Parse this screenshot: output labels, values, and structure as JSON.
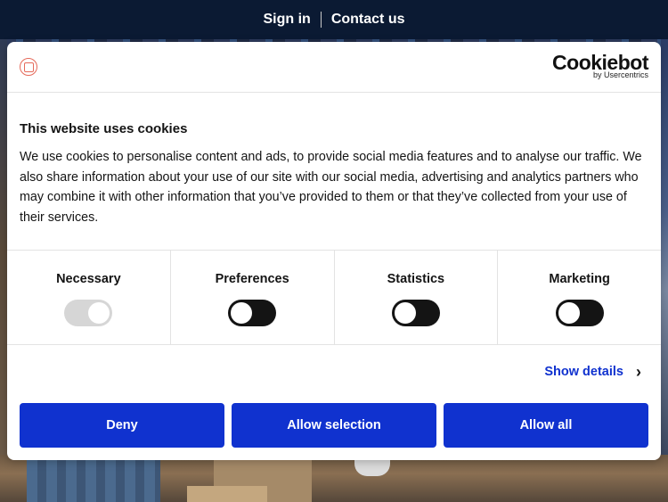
{
  "topbar": {
    "sign_in": "Sign in",
    "contact_us": "Contact us"
  },
  "dialog": {
    "brand_logo_icon": "company-seal-icon",
    "cookiebot_name": "Cookiebot",
    "cookiebot_by": "by Usercentrics",
    "title": "This website uses cookies",
    "text": "We use cookies to personalise content and ads, to provide social media features and to analyse our traffic. We also share information about your use of our site with our social media, advertising and analytics partners who may combine it with other information that you’ve provided to them or that they’ve collected from your use of their services.",
    "categories": [
      {
        "label": "Necessary",
        "checked": true,
        "disabled": true
      },
      {
        "label": "Preferences",
        "checked": false,
        "disabled": false
      },
      {
        "label": "Statistics",
        "checked": false,
        "disabled": false
      },
      {
        "label": "Marketing",
        "checked": false,
        "disabled": false
      }
    ],
    "show_details": "Show details",
    "buttons": {
      "deny": "Deny",
      "allow_selection": "Allow selection",
      "allow_all": "Allow all"
    }
  },
  "colors": {
    "topbar_bg": "#0b1a33",
    "accent_blue": "#1032cf",
    "toggle_off": "#141414",
    "toggle_disabled": "#d6d6d6"
  }
}
